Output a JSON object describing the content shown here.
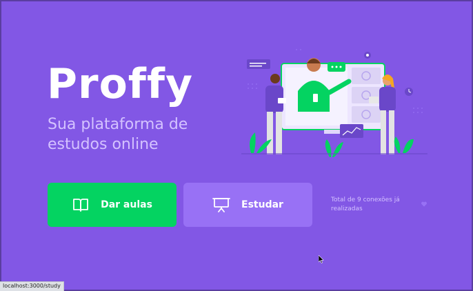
{
  "brand": {
    "logo_text": "Proffy"
  },
  "hero": {
    "tagline": "Sua plataforma de estudos online",
    "illustration": "landing-illustration"
  },
  "actions": {
    "give_classes_label": "Dar aulas",
    "give_classes_icon": "book-icon",
    "study_label": "Estudar",
    "study_icon": "presentation-board-icon"
  },
  "footer": {
    "connections_text": "Total de 9 conexões já realizadas",
    "heart_icon": "heart-icon"
  },
  "browser": {
    "status_url": "localhost:3000/study"
  },
  "colors": {
    "background": "#8257E5",
    "primary_green": "#04D361",
    "secondary_purple": "#9871F5",
    "text_light": "#D4C2FF",
    "white": "#FFFFFF"
  }
}
